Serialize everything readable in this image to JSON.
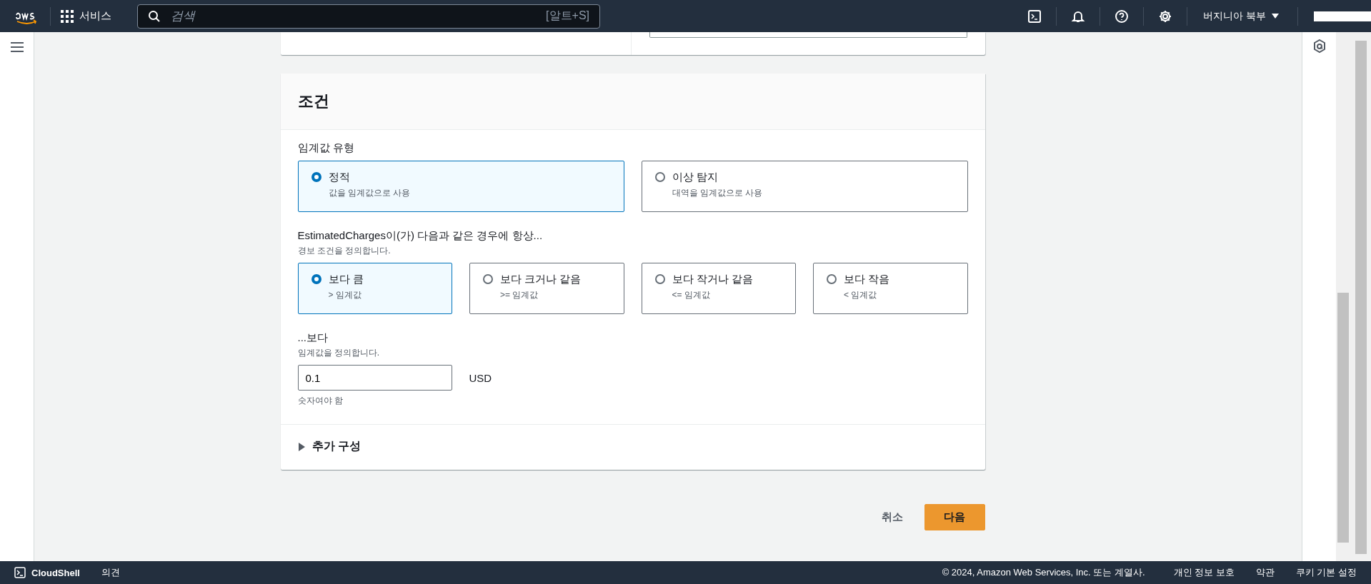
{
  "top_bar": {
    "services": "서비스",
    "search": {
      "placeholder": "검색",
      "shortcut": "[알트+S]"
    },
    "region": "버지니아 북부"
  },
  "condition": {
    "title": "조건",
    "threshold_type": {
      "label": "임계값 유형",
      "options": [
        {
          "title": "정적",
          "description": "값을 임계값으로 사용",
          "selected": true
        },
        {
          "title": "이상 탐지",
          "description": "대역을 임계값으로 사용",
          "selected": false
        }
      ]
    },
    "comparison": {
      "label": "EstimatedCharges이(가) 다음과 같은 경우에 항상...",
      "description": "경보 조건을 정의합니다.",
      "options": [
        {
          "title": "보다 큼",
          "description": "> 임계값",
          "selected": true
        },
        {
          "title": "보다 크거나 같음",
          "description": ">= 임계값",
          "selected": false
        },
        {
          "title": "보다 작거나 같음",
          "description": "<= 임계값",
          "selected": false
        },
        {
          "title": "보다 작음",
          "description": "< 임계값",
          "selected": false
        }
      ]
    },
    "threshold": {
      "label": "...보다",
      "description": "임계값을 정의합니다.",
      "value": "0.1",
      "unit": "USD",
      "hint": "숫자여야 함"
    },
    "additional": {
      "label": "추가 구성",
      "expanded": false
    }
  },
  "actions": {
    "cancel": "취소",
    "next": "다음"
  },
  "footer": {
    "cloudshell": "CloudShell",
    "feedback": "의견",
    "copyright": "© 2024, Amazon Web Services, Inc. 또는 계열사.",
    "links": [
      "개인 정보 보호",
      "약관",
      "쿠키 기본 설정"
    ]
  }
}
